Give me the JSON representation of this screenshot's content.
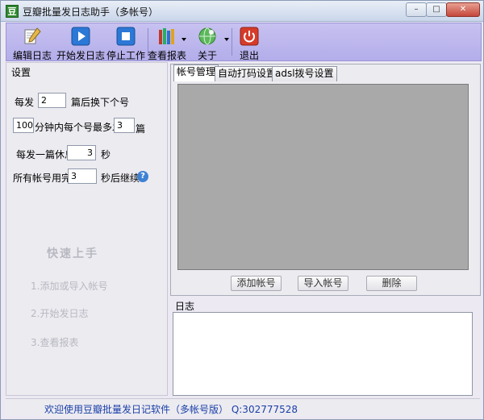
{
  "window": {
    "title": "豆瓣批量发日志助手（多帐号）",
    "app_icon_glyph": "豆",
    "minimize_glyph": "–",
    "maximize_glyph": "□",
    "close_glyph": "✕"
  },
  "toolbar": {
    "items": [
      {
        "label": "编辑日志",
        "icon": "pencil-paper-icon"
      },
      {
        "label": "开始发日志",
        "icon": "play-icon"
      },
      {
        "label": "停止工作",
        "icon": "stop-icon"
      },
      {
        "label": "查看报表",
        "icon": "books-icon"
      },
      {
        "label": "关于",
        "icon": "globe-icon"
      },
      {
        "label": "退出",
        "icon": "power-icon"
      }
    ]
  },
  "settings": {
    "section_label": "设置",
    "row1": {
      "prefix": "每发",
      "value": "2",
      "suffix": "篇后换下个号"
    },
    "row2": {
      "value1": "100",
      "middle": "分钟内每个号最多发",
      "value2": "3",
      "suffix": "篇"
    },
    "row3": {
      "prefix": "每发一篇休息",
      "value": "3",
      "suffix": "秒"
    },
    "row4": {
      "prefix": "所有帐号用完",
      "value": "3",
      "suffix": "秒后继续",
      "help_glyph": "?"
    }
  },
  "quickstart": {
    "title": "快速上手",
    "steps": [
      "1.添加或导入帐号",
      "2.开始发日志",
      "3.查看报表"
    ]
  },
  "tabs": [
    {
      "label": "帐号管理",
      "active": true
    },
    {
      "label": "自动打码设置",
      "active": false
    },
    {
      "label": "adsl拨号设置",
      "active": false
    }
  ],
  "account_buttons": {
    "add": "添加帐号",
    "import": "导入帐号",
    "delete": "删除"
  },
  "log": {
    "label": "日志",
    "content": ""
  },
  "status": {
    "text": "欢迎使用豆瓣批量发日记软件（多帐号版） Q:302777528"
  },
  "colors": {
    "toolbar_bg": "#c7c2f0",
    "status_text": "#1a3fa8",
    "grid_bg": "#a9a9a9"
  }
}
